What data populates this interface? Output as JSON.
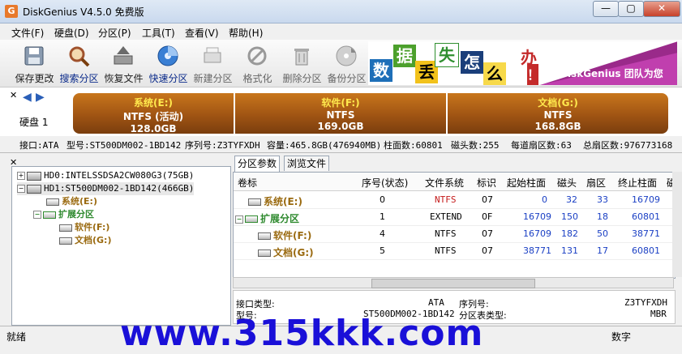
{
  "window": {
    "title": "DiskGenius V4.5.0 免费版",
    "icon_letter": "G",
    "minimize": "—",
    "maximize": "▢",
    "close": "✕"
  },
  "menu": [
    "文件(F)",
    "硬盘(D)",
    "分区(P)",
    "工具(T)",
    "查看(V)",
    "帮助(H)"
  ],
  "toolbar": [
    "保存更改",
    "搜索分区",
    "恢复文件",
    "快速分区",
    "新建分区",
    "格式化",
    "删除分区",
    "备份分区"
  ],
  "banner": {
    "tiles": [
      "数",
      "据",
      "丢",
      "失",
      "怎",
      "么",
      "办",
      "！"
    ],
    "slogan": "DiskGenius 团队为您"
  },
  "diskbar": {
    "disk_label": "硬盘 1",
    "partitions": [
      {
        "name": "系统(E:)",
        "fs": "NTFS (活动)",
        "size": "128.0GB"
      },
      {
        "name": "软件(F:)",
        "fs": "NTFS",
        "size": "169.0GB"
      },
      {
        "name": "文档(G:)",
        "fs": "NTFS",
        "size": "168.8GB"
      }
    ]
  },
  "infobar": {
    "interface": "接口:ATA",
    "model": "型号:ST500DM002-1BD142",
    "serial": "序列号:Z3TYFXDH",
    "capacity": "容量:465.8GB(476940MB)",
    "cylinders": "柱面数:60801",
    "heads": "磁头数:255",
    "sectors": "每道扇区数:63",
    "total": "总扇区数:976773168"
  },
  "tree": {
    "disks": [
      {
        "label": "HD0:INTELSSDSA2CW080G3(75GB)"
      },
      {
        "label": "HD1:ST500DM002-1BD142(466GB)"
      }
    ],
    "part_sys": "系统(E:)",
    "part_ext": "扩展分区",
    "part_soft": "软件(F:)",
    "part_doc": "文档(G:)"
  },
  "tabs": [
    "分区参数",
    "浏览文件"
  ],
  "grid": {
    "headers": [
      "卷标",
      "序号(状态)",
      "文件系统",
      "标识",
      "起始柱面",
      "磁头",
      "扇区",
      "终止柱面",
      "磁"
    ],
    "rows": [
      {
        "label": "系统(E:)",
        "seq": "0",
        "fs": "NTFS",
        "id": "07",
        "start": "0",
        "head": "32",
        "sector": "33",
        "end": "16709"
      },
      {
        "label": "扩展分区",
        "seq": "1",
        "fs": "EXTEND",
        "id": "0F",
        "start": "16709",
        "head": "150",
        "sector": "18",
        "end": "60801"
      },
      {
        "label": "软件(F:)",
        "seq": "4",
        "fs": "NTFS",
        "id": "07",
        "start": "16709",
        "head": "182",
        "sector": "50",
        "end": "38771"
      },
      {
        "label": "文档(G:)",
        "seq": "5",
        "fs": "NTFS",
        "id": "07",
        "start": "38771",
        "head": "131",
        "sector": "17",
        "end": "60801"
      }
    ]
  },
  "detail": {
    "iface_label": "接口类型:",
    "iface_value": "ATA",
    "model_label": "型号:",
    "model_value": "ST500DM002-1BD142",
    "serial_label": "序列号:",
    "serial_value": "Z3TYFXDH",
    "pt_label": "分区表类型:",
    "pt_value": "MBR"
  },
  "status": {
    "left": "就绪",
    "right": "数字"
  },
  "watermark": "www.315kkk.com"
}
